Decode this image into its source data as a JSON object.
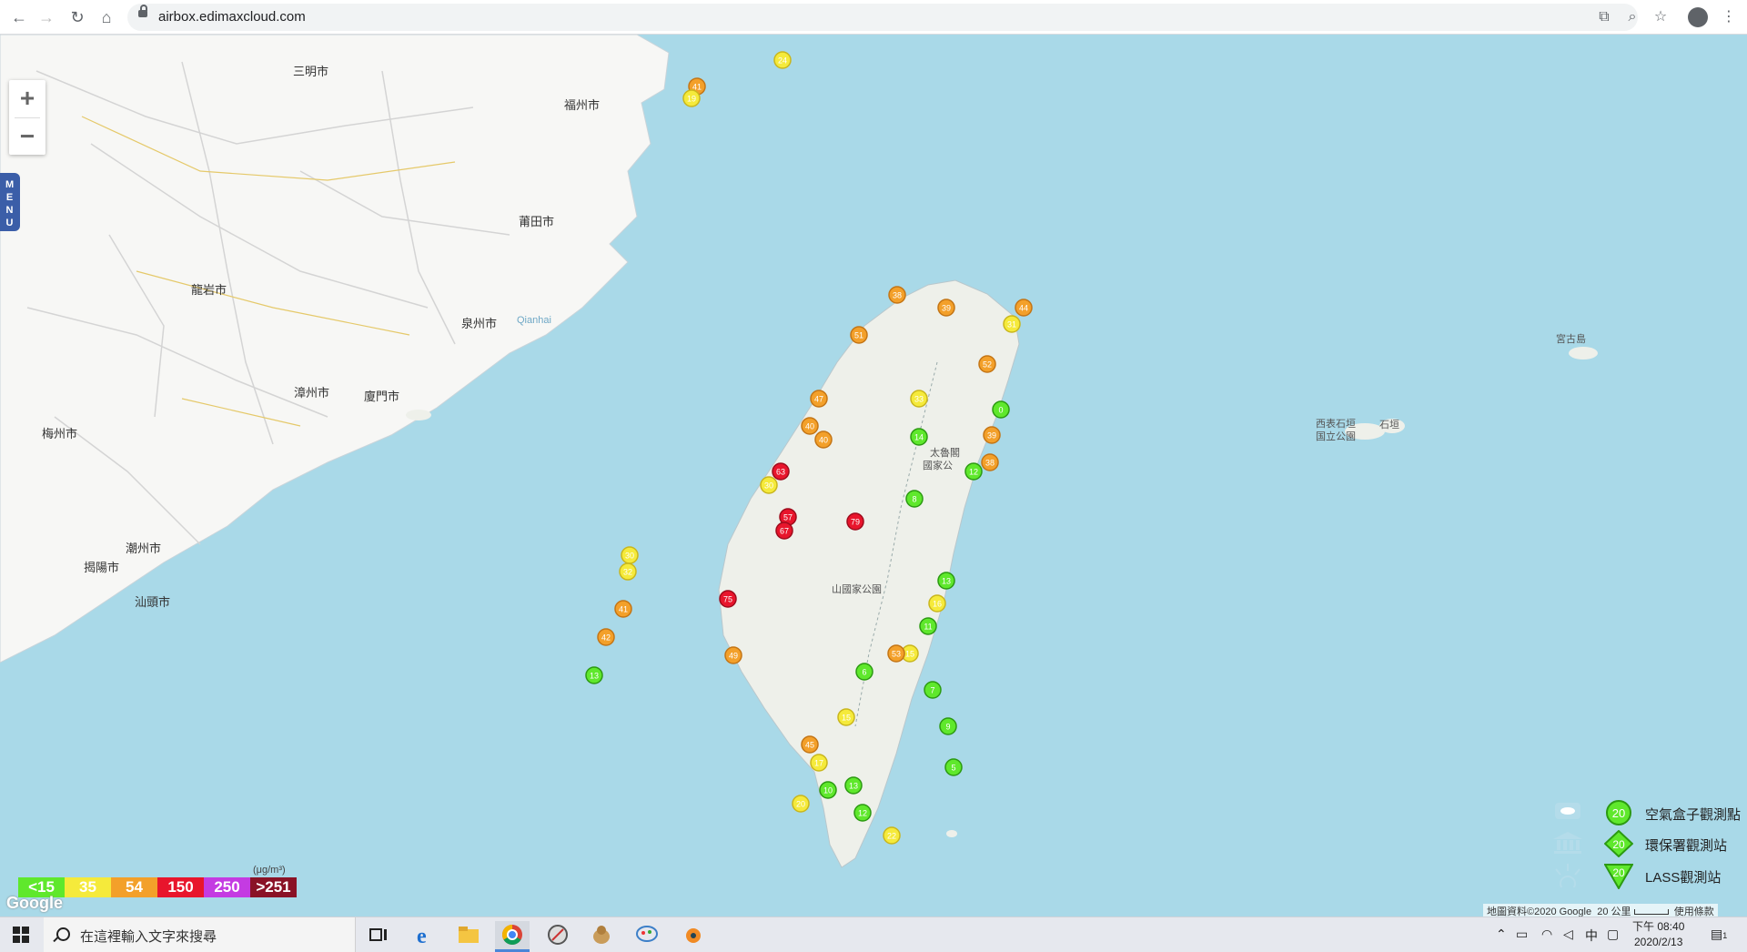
{
  "browser": {
    "url": "airbox.edimaxcloud.com",
    "nav_icons": [
      "back-arrow-icon",
      "forward-arrow-icon",
      "reload-icon",
      "home-icon"
    ],
    "right_icons": [
      "translate-icon",
      "zoom-icon",
      "star-icon",
      "profile-icon",
      "menu-kebab-icon"
    ]
  },
  "map": {
    "zoom_in": "+",
    "zoom_out": "−",
    "menu_label": "MENU",
    "labels": [
      {
        "text": "三明市"
      },
      {
        "text": "福州市"
      },
      {
        "text": "莆田市"
      },
      {
        "text": "龍岩市"
      },
      {
        "text": "泉州市"
      },
      {
        "text": "Qianhai"
      },
      {
        "text": "漳州市"
      },
      {
        "text": "廈門市"
      },
      {
        "text": "梅州市"
      },
      {
        "text": "潮州市"
      },
      {
        "text": "揭陽市"
      },
      {
        "text": "汕頭市"
      },
      {
        "text": "宮古島"
      },
      {
        "text": "西表石垣"
      },
      {
        "text": "国立公園"
      },
      {
        "text": "石垣"
      },
      {
        "text": "太魯閣"
      },
      {
        "text": "國家公"
      },
      {
        "text": "山國家公園"
      }
    ],
    "google": "Google",
    "copyright": "地圖資料©2020 Google",
    "scale_text": "20 公里",
    "terms": "使用條款"
  },
  "aqi_scale": {
    "unit": "(μg/m³)",
    "items": [
      {
        "label": "<15",
        "color": "#5fe82c"
      },
      {
        "label": "35",
        "color": "#f5ea3b"
      },
      {
        "label": "54",
        "color": "#f3a02a"
      },
      {
        "label": "150",
        "color": "#e8152c"
      },
      {
        "label": "250",
        "color": "#c43be2"
      },
      {
        "label": ">251",
        "color": "#8a1226"
      }
    ]
  },
  "station_legend": [
    {
      "label": "空氣盒子觀測點",
      "symbol": "circle",
      "value": "20",
      "icon": "airbox-cloud-icon"
    },
    {
      "label": "環保署觀測站",
      "symbol": "diamond",
      "value": "20",
      "icon": "epa-building-icon"
    },
    {
      "label": "LASS觀測站",
      "symbol": "triangle",
      "value": "20",
      "icon": "lass-sun-icon"
    }
  ],
  "stations": [
    {
      "v": "24"
    },
    {
      "v": "41"
    },
    {
      "v": "19"
    },
    {
      "v": "51"
    },
    {
      "v": "38"
    },
    {
      "v": "39"
    },
    {
      "v": "33"
    },
    {
      "v": "13"
    },
    {
      "v": "41"
    },
    {
      "v": "42"
    },
    {
      "v": "30"
    },
    {
      "v": "32"
    },
    {
      "v": "44"
    },
    {
      "v": "31"
    },
    {
      "v": "52"
    },
    {
      "v": "79"
    },
    {
      "v": "57"
    },
    {
      "v": "75"
    },
    {
      "v": "49"
    },
    {
      "v": "39"
    },
    {
      "v": "38"
    },
    {
      "v": "40"
    },
    {
      "v": "40"
    },
    {
      "v": "30"
    },
    {
      "v": "14"
    },
    {
      "v": "12"
    },
    {
      "v": "13"
    },
    {
      "v": "16"
    },
    {
      "v": "11"
    },
    {
      "v": "15"
    },
    {
      "v": "6"
    },
    {
      "v": "8"
    },
    {
      "v": "9"
    },
    {
      "v": "7"
    },
    {
      "v": "5"
    },
    {
      "v": "0"
    },
    {
      "v": "53"
    },
    {
      "v": "15"
    },
    {
      "v": "13"
    },
    {
      "v": "12"
    },
    {
      "v": "22"
    },
    {
      "v": "17"
    },
    {
      "v": "10"
    },
    {
      "v": "20"
    },
    {
      "v": "45"
    },
    {
      "v": "47"
    },
    {
      "v": "63"
    },
    {
      "v": "67"
    }
  ],
  "taskbar": {
    "search_placeholder": "在這裡輸入文字來搜尋",
    "ime": "中",
    "time": "下午 08:40",
    "date": "2020/2/13",
    "notification_count": "1"
  }
}
